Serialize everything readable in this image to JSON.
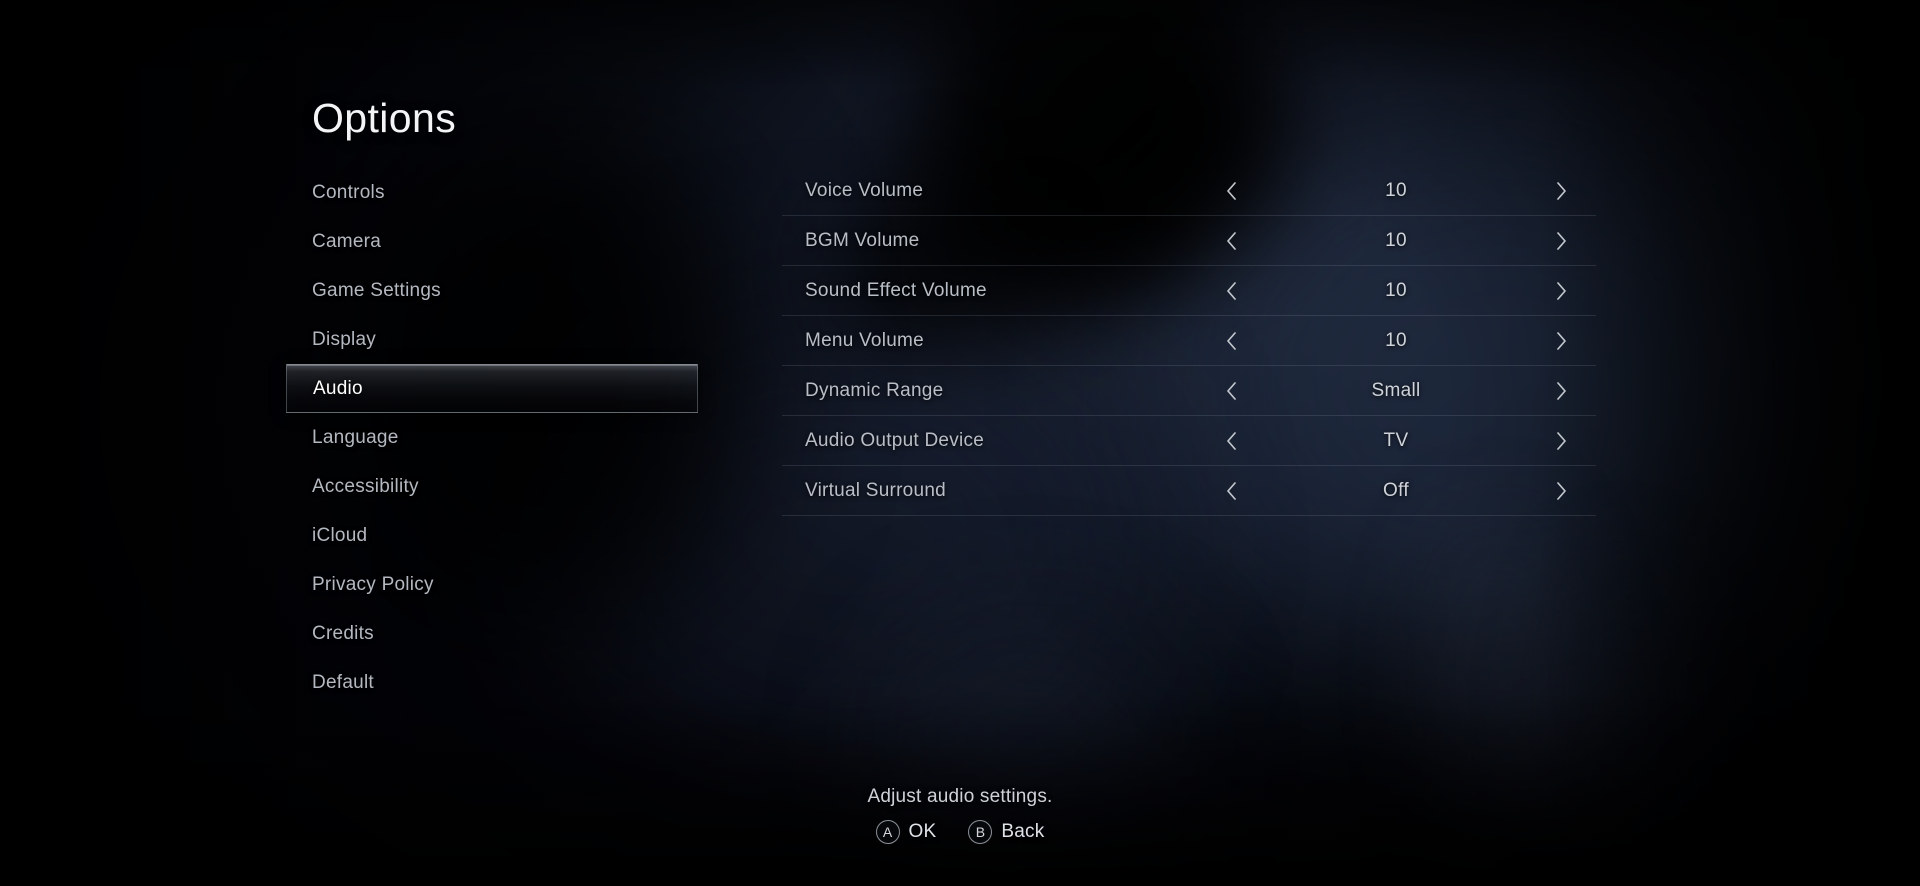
{
  "screen": {
    "title": "Options",
    "background_accent": "#121826",
    "highlight_color": "#8a909c"
  },
  "sidebar": {
    "selected_index": 4,
    "items": [
      {
        "label": "Controls"
      },
      {
        "label": "Camera"
      },
      {
        "label": "Game Settings"
      },
      {
        "label": "Display"
      },
      {
        "label": "Audio"
      },
      {
        "label": "Language"
      },
      {
        "label": "Accessibility"
      },
      {
        "label": "iCloud"
      },
      {
        "label": "Privacy Policy"
      },
      {
        "label": "Credits"
      },
      {
        "label": "Default"
      }
    ]
  },
  "settings": {
    "rows": [
      {
        "label": "Voice Volume",
        "value": "10"
      },
      {
        "label": "BGM Volume",
        "value": "10"
      },
      {
        "label": "Sound Effect Volume",
        "value": "10"
      },
      {
        "label": "Menu Volume",
        "value": "10"
      },
      {
        "label": "Dynamic Range",
        "value": "Small"
      },
      {
        "label": "Audio Output Device",
        "value": "TV"
      },
      {
        "label": "Virtual Surround",
        "value": "Off"
      }
    ],
    "decrement_icon": "chevron-left-icon",
    "increment_icon": "chevron-right-icon"
  },
  "footer": {
    "hint": "Adjust audio settings.",
    "prompts": [
      {
        "button": "A",
        "label": "OK"
      },
      {
        "button": "B",
        "label": "Back"
      }
    ]
  }
}
